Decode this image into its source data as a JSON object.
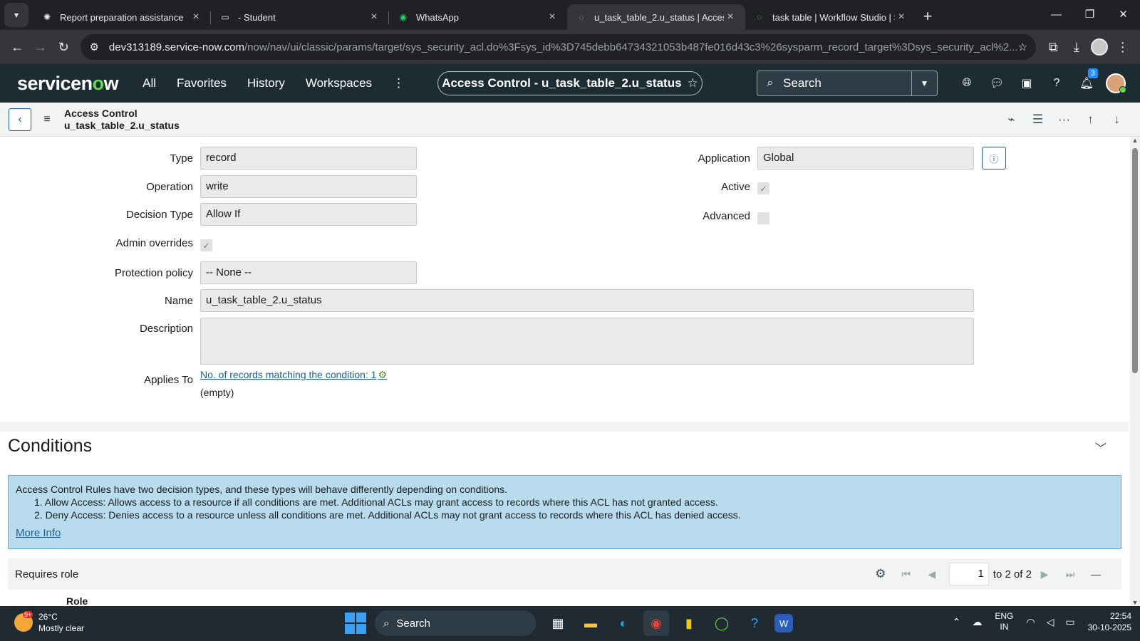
{
  "browser": {
    "tabs": [
      {
        "title": "Report preparation assistance",
        "icon": "openai-icon",
        "active": false
      },
      {
        "title": "- Student",
        "icon": "portal-icon",
        "active": false
      },
      {
        "title": "WhatsApp",
        "icon": "whatsapp-icon",
        "active": false
      },
      {
        "title": "u_task_table_2.u_status | Access",
        "icon": "servicenow-icon",
        "active": true
      },
      {
        "title": "task table | Workflow Studio | S",
        "icon": "servicenow-icon",
        "active": false
      }
    ],
    "url_host": "dev313189.service-now.com",
    "url_path": "/now/nav/ui/classic/params/target/sys_security_acl.do%3Fsys_id%3D745debb64734321053b487fe016d43c3%26sysparm_record_target%3Dsys_security_acl%2..."
  },
  "header": {
    "logo_pre": "servicen",
    "logo_o": "o",
    "logo_post": "w",
    "nav": [
      "All",
      "Favorites",
      "History",
      "Workspaces"
    ],
    "context_title": "Access Control - u_task_table_2.u_status",
    "search_placeholder": "Search",
    "notification_count": "3"
  },
  "formbar": {
    "title_line1": "Access Control",
    "title_line2": "u_task_table_2.u_status"
  },
  "form": {
    "type_label": "Type",
    "type_value": "record",
    "operation_label": "Operation",
    "operation_value": "write",
    "decision_type_label": "Decision Type",
    "decision_type_value": "Allow If",
    "admin_overrides_label": "Admin overrides",
    "admin_overrides_checked": true,
    "protection_policy_label": "Protection policy",
    "protection_policy_value": "-- None --",
    "name_label": "Name",
    "name_value": "u_task_table_2.u_status",
    "description_label": "Description",
    "description_value": "",
    "applies_to_label": "Applies To",
    "applies_to_link": "No. of records matching the condition: 1",
    "applies_to_empty": "(empty)",
    "application_label": "Application",
    "application_value": "Global",
    "active_label": "Active",
    "active_checked": true,
    "advanced_label": "Advanced",
    "advanced_checked": false
  },
  "conditions": {
    "title": "Conditions",
    "notice_intro": "Access Control Rules have two decision types, and these types will behave differently depending on conditions.",
    "notice_item1": "1. Allow Access: Allows access to a resource if all conditions are met. Additional ACLs may grant access to records where this ACL has not granted access.",
    "notice_item2": "2. Deny Access: Denies access to a resource unless all conditions are met. Additional ACLs may not grant access to records where this ACL has denied access.",
    "more_info": "More Info"
  },
  "related_list": {
    "title": "Requires role",
    "page_value": "1",
    "page_text": "to 2 of 2",
    "column_role": "Role"
  },
  "taskbar": {
    "weather_badge": "9+",
    "temperature": "26°C",
    "condition": "Mostly clear",
    "search_label": "Search",
    "lang_line1": "ENG",
    "lang_line2": "IN",
    "time": "22:54",
    "date": "30-10-2025"
  }
}
